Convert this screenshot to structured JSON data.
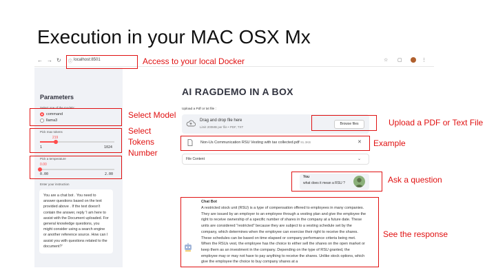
{
  "slide": {
    "title": "Execution in your MAC OSX Mx"
  },
  "browser": {
    "url": "localhost:8501",
    "back": "←",
    "forward": "→",
    "reload": "↻",
    "star": "☆",
    "menu": "⋮"
  },
  "sidebar": {
    "title": "Parameters",
    "model_label": "Select one of the models:",
    "models": [
      "command",
      "llama3"
    ],
    "selected_model": "command",
    "tokens": {
      "label": "Pick max tokens",
      "value": "219",
      "min": "1",
      "max": "1024",
      "fraction": 0.213
    },
    "temperature": {
      "label": "Pick a temperature",
      "value": "0.00",
      "min": "0.00",
      "max": "2.00",
      "fraction": 0.0
    },
    "instruction_label": "Enter your instruction",
    "instruction_text": "You are a chat bot . You need to answer questions based on the text provided above . If the text doesn't contain the answer, reply 'I am here to assist with the Document uploaded. For general knowledge questions, you might consider using a search engine or another reference source. How can I assist you with questions related to the document?'"
  },
  "main": {
    "title": "AI RAGDEMO IN A BOX",
    "upload_label": "Upload a Pdf or txt file :",
    "drop_main": "Drag and drop file here",
    "drop_sub": "Limit 200MB per file • PDF, TXT",
    "browse_label": "Browse files",
    "file_name": "Non-Us Communication RSU Vesting with tax collected.pdf",
    "file_size": "91.3KB",
    "close_glyph": "✕",
    "expander_label": "File Content",
    "expander_chevron": "⌄"
  },
  "chat": {
    "user_name": "You",
    "user_text": "what does it mean a RSU ?",
    "bot_name": "Chat Bot",
    "bot_text": "A restricted stock unit (RSU) is a type of compensation offered to employees in many companies. They are issued by an employer to an employee through a vesting plan and give the employee the right to receive ownership of a specific number of shares in the company at a future date. These units are considered \"restricted\" because they are subject to a vesting schedule set by the company, which determines when the employee can exercise their right to receive the shares. These schedules can be based on time elapsed or company performance criteria being met. When the RSUs vest, the employee has the choice to either sell the shares on the open market or keep them as an investment in the company. Depending on the type of RSU granted, the employee may or may not have to pay anything to receive the shares. Unlike stock options, which give the employee the choice to buy company shares at a"
  },
  "annotations": {
    "docker": "Access to your local Docker",
    "model": "Select Model",
    "tokens": "Select\nTokens\nNumber",
    "upload": "Upload a PDF or Text File",
    "example": "Example",
    "ask": "Ask a question",
    "response": "See the response"
  },
  "colors": {
    "annotation": "#e01010",
    "accent": "#ff4b4b",
    "sidebar_bg": "#f0f2f6"
  }
}
